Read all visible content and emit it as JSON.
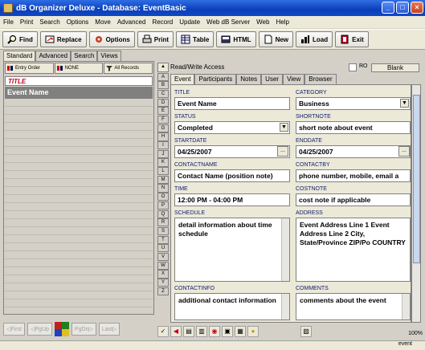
{
  "title": "dB Organizer Deluxe - Database: EventBasic",
  "menu": [
    "File",
    "Print",
    "Search",
    "Options",
    "Move",
    "Advanced",
    "Record",
    "Update",
    "Web dB Server",
    "Web",
    "Help"
  ],
  "toolbar": {
    "find": "Find",
    "replace": "Replace",
    "options": "Options",
    "print": "Print",
    "table": "Table",
    "html": "HTML",
    "new": "New",
    "load": "Load",
    "exit": "Exit"
  },
  "left_tabs": [
    "Standard",
    "Advanced",
    "Search",
    "Views"
  ],
  "sort": [
    "Entry Order",
    "NONE",
    "All Records"
  ],
  "list": {
    "header": "TITLE",
    "selected": "Event Name"
  },
  "bottom_nav": {
    "first": "First",
    "pgup": "PgUp",
    "pgdn": "PgDn",
    "last": "Last"
  },
  "alphabet": [
    "A",
    "B",
    "C",
    "D",
    "E",
    "F",
    "G",
    "H",
    "I",
    "J",
    "K",
    "L",
    "M",
    "N",
    "O",
    "P",
    "Q",
    "R",
    "S",
    "T",
    "U",
    "V",
    "W",
    "X",
    "Y",
    "Z"
  ],
  "read_write": "Read/Write Access",
  "ro_label": "RO",
  "blank_button": "Blank",
  "record_tabs": [
    "Event",
    "Participants",
    "Notes",
    "User",
    "View",
    "Browser"
  ],
  "fields": {
    "title": {
      "label": "TITLE",
      "value": "Event Name"
    },
    "category": {
      "label": "CATEGORY",
      "value": "Business"
    },
    "status": {
      "label": "STATUS",
      "value": "Completed"
    },
    "shortnote": {
      "label": "SHORTNOTE",
      "value": "short note about event"
    },
    "startdate": {
      "label": "STARTDATE",
      "value": "04/25/2007"
    },
    "enddate": {
      "label": "ENDDATE",
      "value": "04/25/2007"
    },
    "contactname": {
      "label": "CONTACTNAME",
      "value": "Contact Name (position note)"
    },
    "contactby": {
      "label": "CONTACTBY",
      "value": "phone number, mobile, email a"
    },
    "time": {
      "label": "TIME",
      "value": "12:00 PM - 04:00 PM"
    },
    "costnote": {
      "label": "COSTNOTE",
      "value": "cost note if applicable"
    },
    "schedule": {
      "label": "SCHEDULE",
      "value": "detail information about time schedule"
    },
    "address": {
      "label": "ADDRESS",
      "value": "Event Address Line 1 Event Address Line 2 City, State/Province ZIP/Po COUNTRY"
    },
    "contactinfo": {
      "label": "CONTACTINFO",
      "value": "additional contact information"
    },
    "comments": {
      "label": "COMMENTS",
      "value": "comments about the event"
    }
  },
  "dots": "...",
  "zoom": "100%",
  "status_text": "event"
}
